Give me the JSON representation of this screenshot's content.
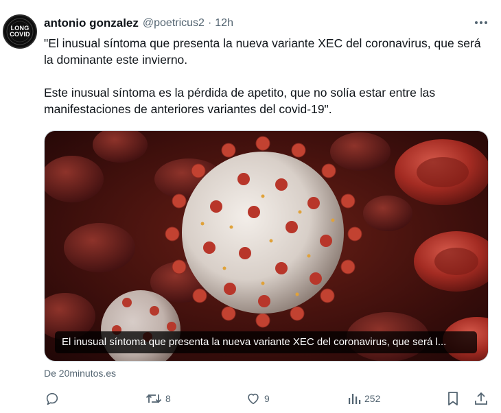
{
  "avatar": {
    "line1": "LONG",
    "line2": "COVID",
    "ring_text": "LONG COVID AWARENESS"
  },
  "author": {
    "name": "antonio gonzalez",
    "handle": "@poetricus2",
    "separator": "·",
    "time": "12h"
  },
  "tweet_text": "\"El inusual síntoma que presenta la nueva variante XEC del coronavirus, que será la dominante este invierno.\n\nEste inusual síntoma es la pérdida de apetito, que no solía estar entre las manifestaciones de anteriores variantes del covid-19\".",
  "card": {
    "caption": "El inusual síntoma que presenta la nueva variante XEC del coronavirus, que será l...",
    "source": "De 20minutos.es"
  },
  "actions": {
    "reply_count": "",
    "retweet_count": "8",
    "like_count": "9",
    "views_count": "252"
  },
  "colors": {
    "text": "#0f1419",
    "muted": "#536471",
    "border": "#cfd9de"
  },
  "icons": [
    "more-icon",
    "reply-icon",
    "retweet-icon",
    "like-icon",
    "views-icon",
    "bookmark-icon",
    "share-icon"
  ]
}
